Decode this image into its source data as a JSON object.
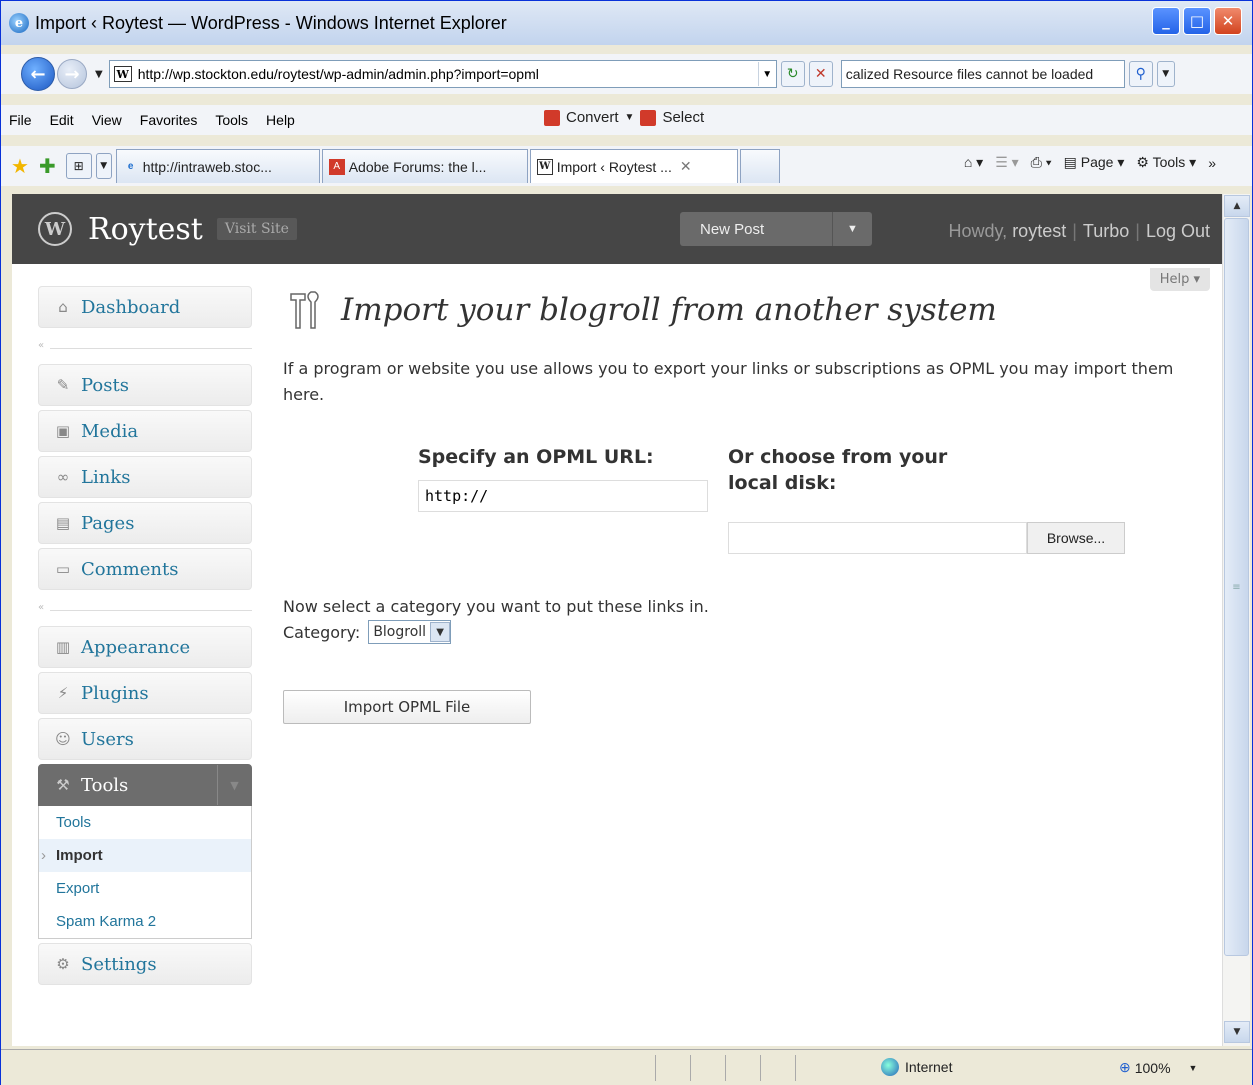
{
  "window": {
    "title": "Import ‹ Roytest — WordPress - Windows Internet Explorer",
    "minimize": "_",
    "maximize": "□",
    "close": "✕"
  },
  "address": {
    "url": "http://wp.stockton.edu/roytest/wp-admin/admin.php?import=opml",
    "search_text": "calized Resource files cannot be loaded"
  },
  "menu": {
    "items": [
      "File",
      "Edit",
      "View",
      "Favorites",
      "Tools",
      "Help"
    ],
    "convert": "Convert",
    "select": "Select"
  },
  "tabs": [
    {
      "label": "http://intraweb.stoc...",
      "icon": "ie-icon"
    },
    {
      "label": "Adobe Forums: the l...",
      "icon": "adobe-icon"
    },
    {
      "label": "Import ‹ Roytest ...",
      "icon": "wp-favicon",
      "active": true
    }
  ],
  "ietools": {
    "page": "Page",
    "tools": "Tools"
  },
  "wp": {
    "site_name": "Roytest",
    "visit_site": "Visit Site",
    "new_post": "New Post",
    "howdy": "Howdy,",
    "user": "roytest",
    "turbo": "Turbo",
    "logout": "Log Out",
    "help": "Help"
  },
  "sidebar": {
    "dashboard": "Dashboard",
    "posts": "Posts",
    "media": "Media",
    "links": "Links",
    "pages": "Pages",
    "comments": "Comments",
    "appearance": "Appearance",
    "plugins": "Plugins",
    "users": "Users",
    "tools": "Tools",
    "tools_sub": [
      "Tools",
      "Import",
      "Export",
      "Spam Karma 2"
    ],
    "settings": "Settings"
  },
  "main": {
    "heading": "Import your blogroll from another system",
    "description": "If a program or website you use allows you to export your links or subscriptions as OPML you may import them here.",
    "url_heading": "Specify an OPML URL:",
    "url_value": "http://",
    "local_heading": "Or choose from your local disk:",
    "browse": "Browse...",
    "category_note": "Now select a category you want to put these links in.",
    "category_label": "Category:",
    "category_value": "Blogroll",
    "import_button": "Import OPML File"
  },
  "status": {
    "zone": "Internet",
    "zoom": "100%"
  }
}
